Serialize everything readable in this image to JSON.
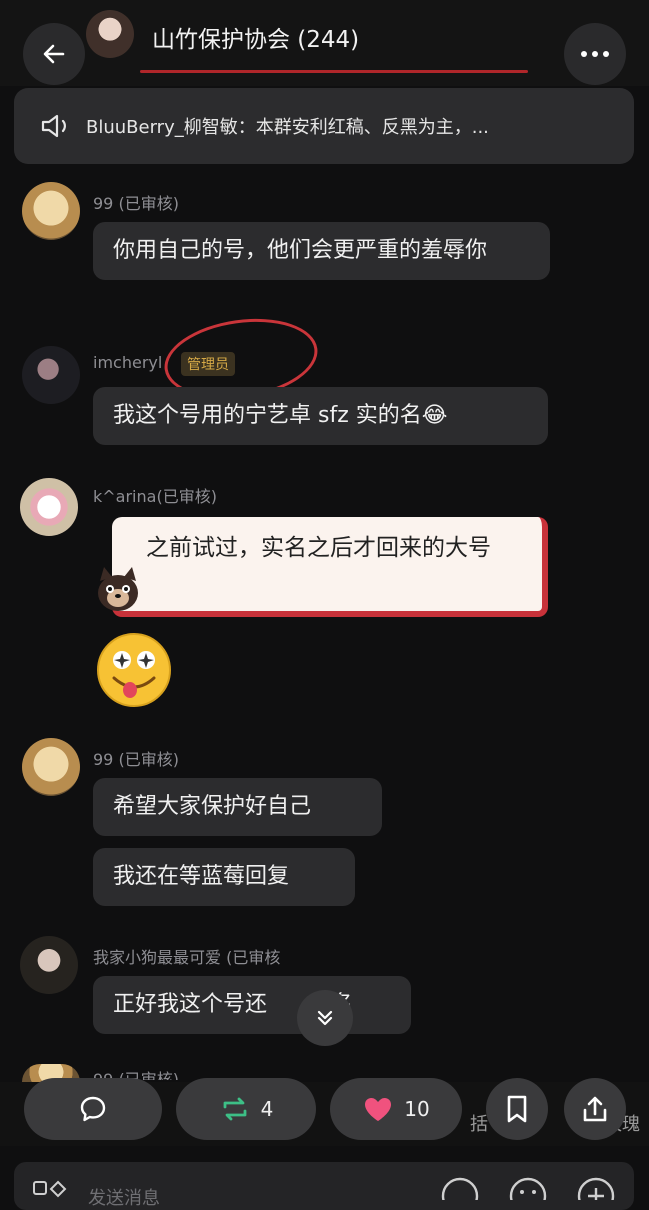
{
  "header": {
    "group_name": "山竹保护协会 (244)"
  },
  "notice": {
    "text": "BluuBerry_柳智敏：本群安利红稿、反黑为主，..."
  },
  "messages": [
    {
      "user": "99 (已审核)",
      "text": "你用自己的号，他们会更严重的羞辱你"
    },
    {
      "user": "imcheryl",
      "badge": "管理员",
      "text": "我这个号用的宁艺卓 sfz 实的名😂"
    },
    {
      "user": "k^arina(已审核)",
      "text": "之前试过，实名之后才回来的大号"
    },
    {
      "user": "99 (已审核)",
      "texts": [
        "希望大家保护好自己",
        "我还在等蓝莓回复"
      ]
    },
    {
      "user": "我家小狗最最可爱 (已审核",
      "text": "正好我这个号还没实名",
      "text_visible": "正好我这个号还",
      "text_tail": "名"
    }
  ],
  "partial_next_user": "99 (已审核)",
  "actions": {
    "repost_count": "4",
    "like_count": "10",
    "behind_text_left": "括",
    "behind_text_right": "玫瑰"
  },
  "composer": {
    "placeholder": "发送消息"
  }
}
